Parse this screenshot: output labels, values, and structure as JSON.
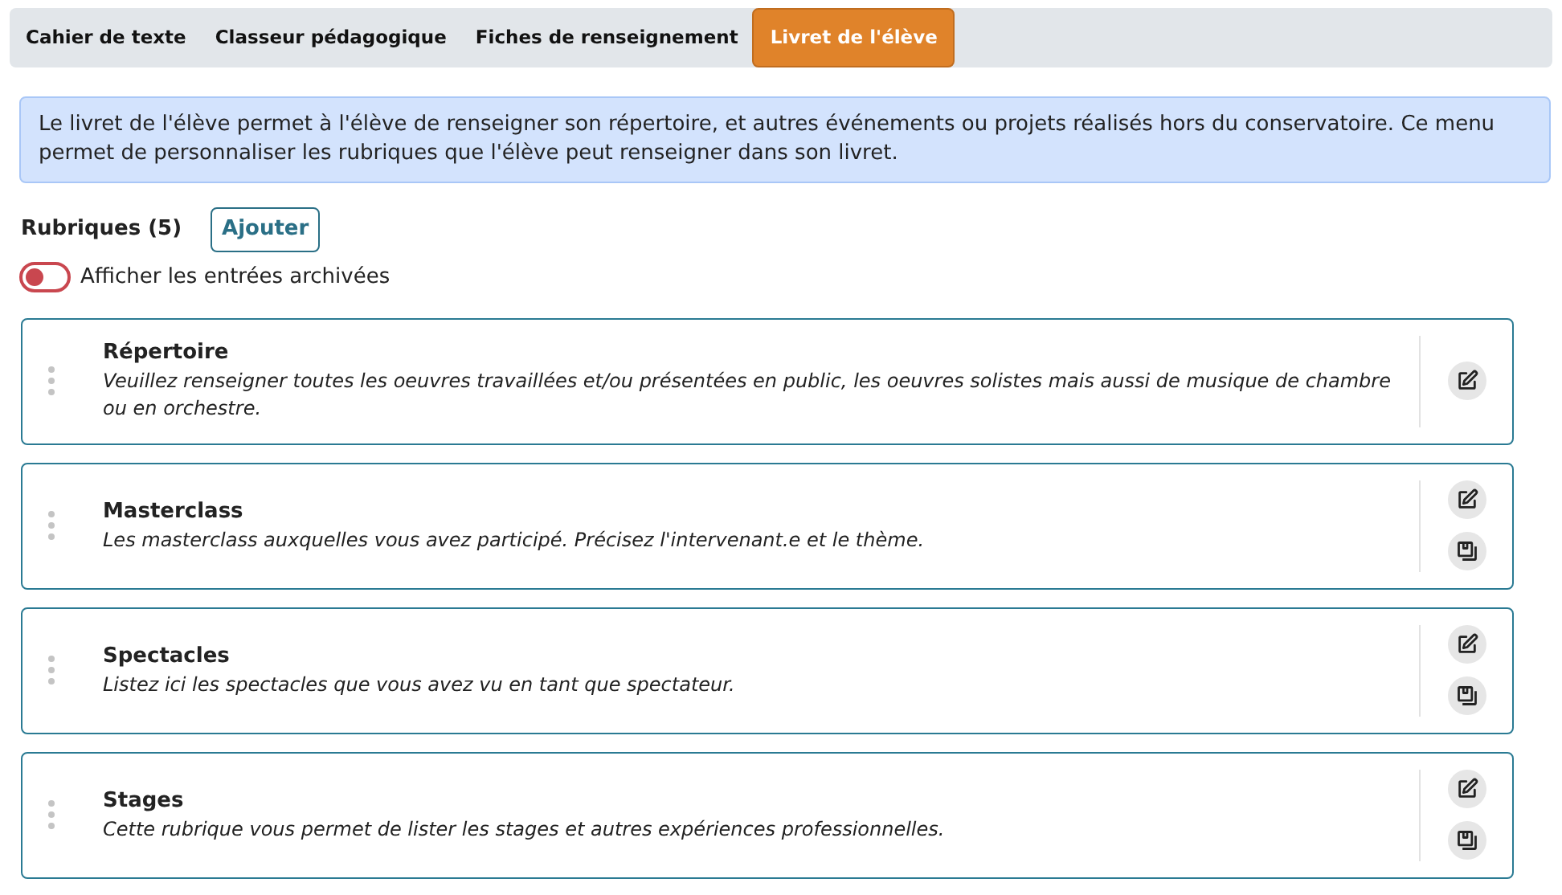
{
  "tabs": [
    {
      "label": "Cahier de texte",
      "selected": false
    },
    {
      "label": "Classeur pédagogique",
      "selected": false
    },
    {
      "label": "Fiches de renseignement",
      "selected": false
    },
    {
      "label": "Livret de l'élève",
      "selected": true
    }
  ],
  "info": "Le livret de l'élève permet à l'élève de renseigner son répertoire, et autres événements ou projets réalisés hors du conservatoire. Ce menu permet de personnaliser les rubriques que l'élève peut renseigner dans son livret.",
  "section": {
    "title": "Rubriques (5)",
    "add_button": "Ajouter"
  },
  "archived_toggle": {
    "label": "Afficher les entrées archivées",
    "on": false
  },
  "rubriques": [
    {
      "title": "Répertoire",
      "description": "Veuillez renseigner toutes les oeuvres travaillées et/ou présentées en public, les oeuvres solistes mais aussi de musique de chambre ou en orchestre.",
      "archivable": false
    },
    {
      "title": "Masterclass",
      "description": "Les masterclass auxquelles vous avez participé. Précisez l'intervenant.e et le thème.",
      "archivable": true
    },
    {
      "title": "Spectacles",
      "description": "Listez ici les spectacles que vous avez vu en tant que spectateur.",
      "archivable": true
    },
    {
      "title": "Stages",
      "description": "Cette rubrique vous permet de lister les stages et autres expériences professionnelles.",
      "archivable": true
    }
  ]
}
